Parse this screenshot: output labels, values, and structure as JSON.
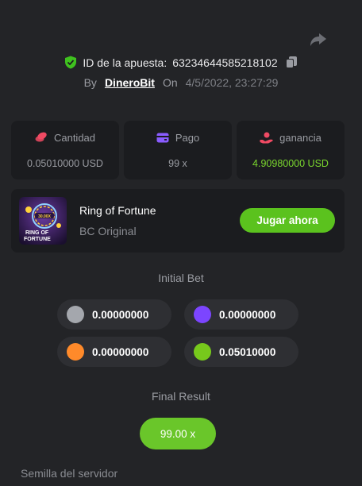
{
  "header": {
    "share_icon": "share-arrow-icon",
    "bet_id_label": "ID de la apuesta:",
    "bet_id": "63234644585218102",
    "by_label": "By",
    "user": "DineroBit",
    "on_label": "On",
    "datetime": "4/5/2022, 23:27:29"
  },
  "stats": [
    {
      "label": "Cantidad",
      "value": "0.05010000 USD",
      "icon": "coins-icon",
      "icon_color": "#f04a63"
    },
    {
      "label": "Pago",
      "value": "99 x",
      "icon": "wallet-icon",
      "icon_color": "#8a5cff"
    },
    {
      "label": "ganancia",
      "value": "4.90980000 USD",
      "icon": "hand-money-icon",
      "icon_color": "#f04a63",
      "value_color": "#7ad62e"
    }
  ],
  "game": {
    "name": "Ring of Fortune",
    "subtitle": "BC Original",
    "play_label": "Jugar ahora",
    "thumb_text_top": "30.00X",
    "thumb_text_1": "RING OF",
    "thumb_text_2": "FORTUNE"
  },
  "initial_bet": {
    "title": "Initial Bet",
    "bets": [
      {
        "color": "#a4a7ad",
        "amount": "0.00000000"
      },
      {
        "color": "#7c45ff",
        "amount": "0.00000000"
      },
      {
        "color": "#ff8a2a",
        "amount": "0.00000000"
      },
      {
        "color": "#77c91c",
        "amount": "0.05010000"
      }
    ]
  },
  "final_result": {
    "title": "Final Result",
    "value": "99.00 x"
  },
  "seed": {
    "label": "Semilla del servidor"
  }
}
